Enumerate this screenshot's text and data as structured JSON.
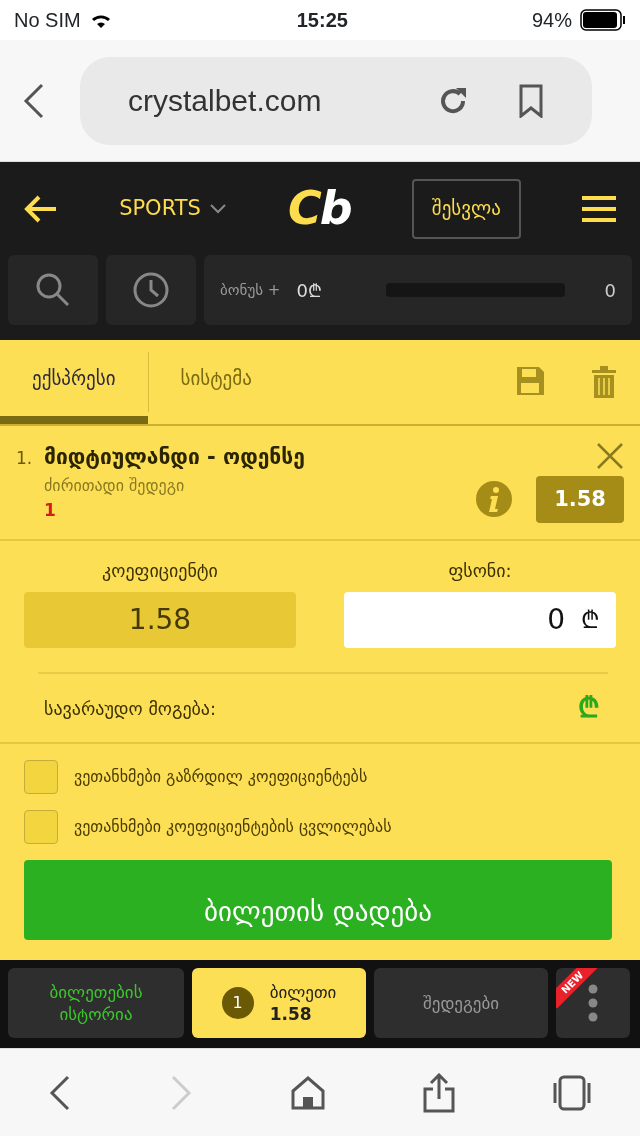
{
  "status_bar": {
    "carrier": "No SIM",
    "time": "15:25",
    "battery": "94%"
  },
  "browser": {
    "url": "crystalbet.com"
  },
  "header": {
    "sports": "SPORTS",
    "logo_first": "C",
    "logo_second": "b",
    "login": "შესვლა"
  },
  "toolbar": {
    "bonus_label": "ბონუს +",
    "bonus_amount": "0₾",
    "bonus_bar": {
      "level": 0
    },
    "bonus_count": "0"
  },
  "tabs": [
    {
      "label": "ექსპრესი",
      "selected": true
    },
    {
      "label": "სისტემა",
      "selected": false
    }
  ],
  "bets": [
    {
      "number": "1.",
      "match": "მიდტიულანდი - ოდენსე",
      "market": "ძირითადი შედეგი",
      "pick": "1",
      "odds": "1.58"
    }
  ],
  "odds_label": "კოეფიციენტი",
  "odds_value": "1.58",
  "stake_label": "ფსონი:",
  "stake_value": "0",
  "stake_currency": "₾",
  "win_label": "სავარაუდო მოგება:",
  "win_currency": "₾",
  "agreements": [
    {
      "label": "ვეთანხმები გაზრდილ კოეფიციენტებს",
      "checked": false
    },
    {
      "label": "ვეთანხმები კოეფიციენტების ცვლილებას",
      "checked": false
    }
  ],
  "place_bet": "ბილეთის დადება",
  "bottom_nav": [
    {
      "kind": "history",
      "label": "ბილეთების ისტორია",
      "selected": false
    },
    {
      "kind": "slip",
      "count": "1",
      "label": "ბილეთი",
      "odds": "1.58",
      "selected": true
    },
    {
      "kind": "results",
      "label": "შედეგები",
      "selected": false
    },
    {
      "kind": "more",
      "badge": "NEW",
      "selected": false
    }
  ]
}
